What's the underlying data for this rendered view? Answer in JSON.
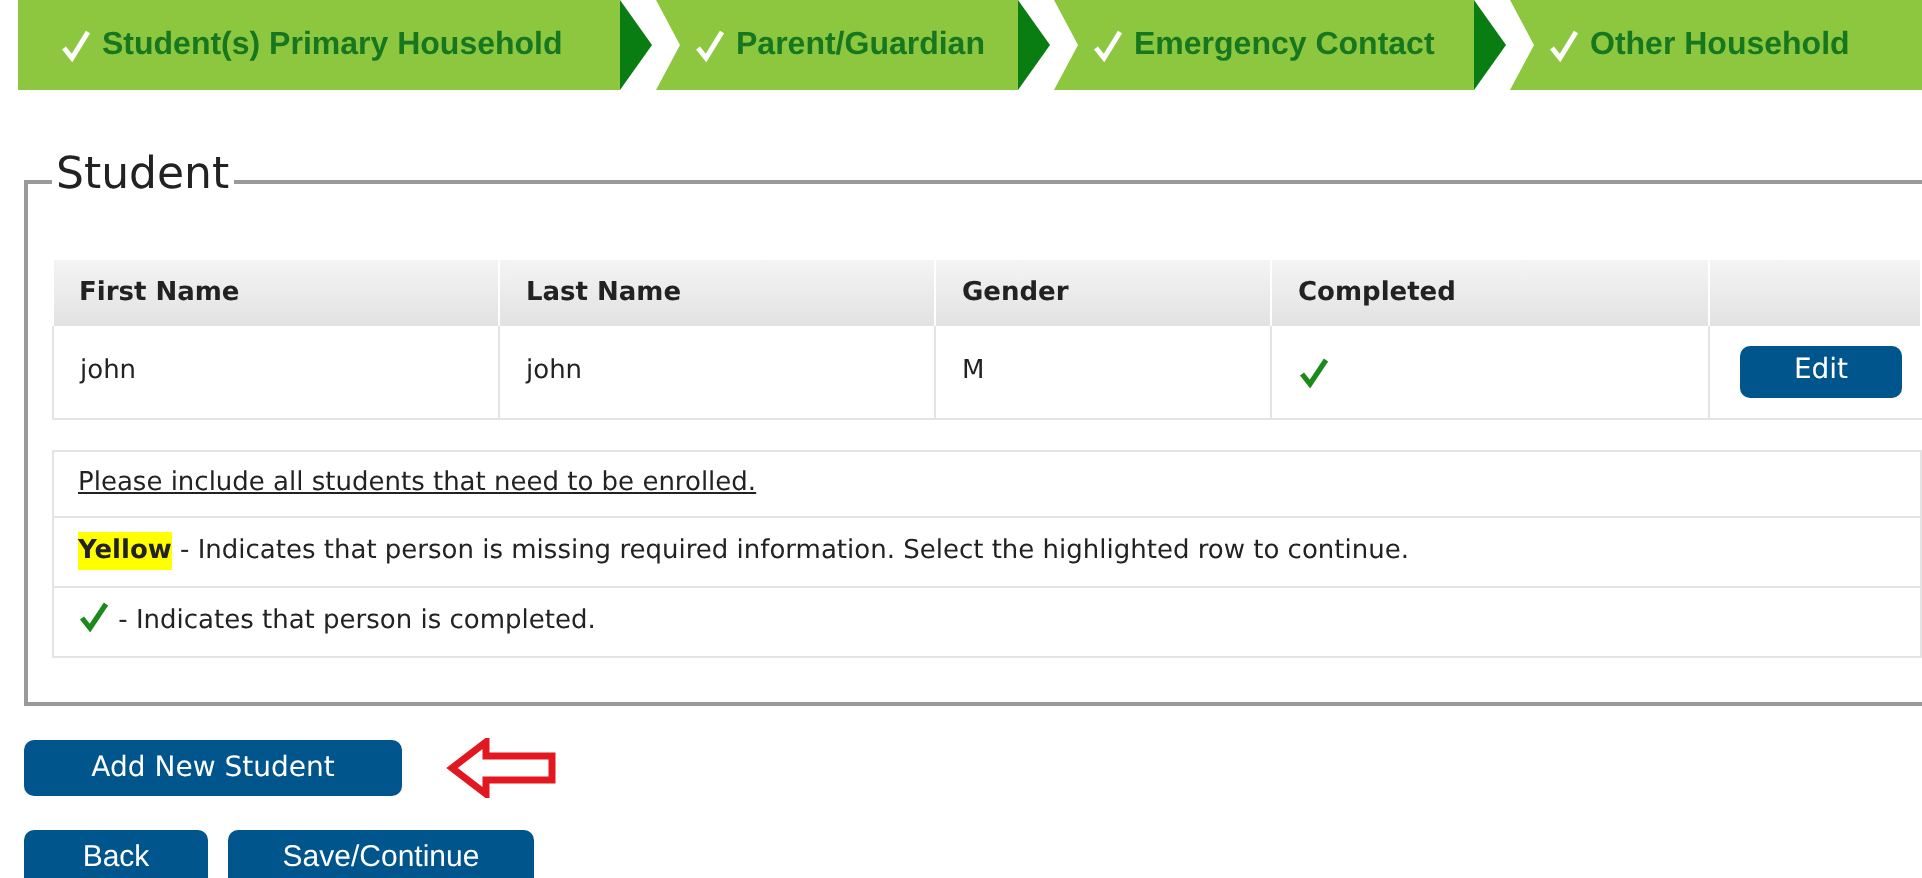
{
  "steps": [
    {
      "label": "Student(s) Primary Household",
      "completed": true
    },
    {
      "label": "Parent/Guardian",
      "completed": true
    },
    {
      "label": "Emergency Contact",
      "completed": true
    },
    {
      "label": "Other Household",
      "completed": true
    }
  ],
  "section": {
    "title": "Student",
    "table": {
      "columns": [
        "First Name",
        "Last Name",
        "Gender",
        "Completed"
      ],
      "rows": [
        {
          "first_name": "john",
          "last_name": "john",
          "gender": "M",
          "completed": true,
          "action": "Edit"
        }
      ]
    },
    "notes": [
      {
        "kind": "link",
        "text": "Please include all students that need to be enrolled."
      },
      {
        "kind": "highlight",
        "label": "Yellow",
        "text": " - Indicates that person is missing required information. Select the highlighted row to continue."
      },
      {
        "kind": "check",
        "text": " - Indicates that person is completed."
      }
    ]
  },
  "add_button": "Add New Student",
  "nav_buttons": [
    "Back",
    "Save/Continue"
  ]
}
